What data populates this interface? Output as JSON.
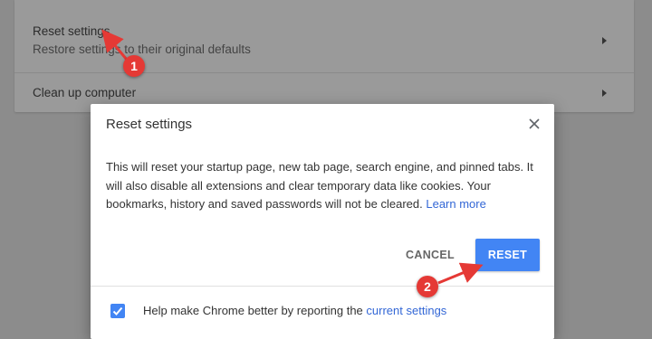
{
  "settings_card": {
    "reset_row": {
      "title": "Reset settings",
      "subtitle": "Restore settings to their original defaults"
    },
    "cleanup_row": {
      "title": "Clean up computer"
    }
  },
  "dialog": {
    "title": "Reset settings",
    "body_text": "This will reset your startup page, new tab page, search engine, and pinned tabs. It will also disable all extensions and clear temporary data like cookies. Your bookmarks, history and saved passwords will not be cleared.",
    "learn_more": "Learn more",
    "cancel_label": "CANCEL",
    "reset_label": "RESET",
    "footer": {
      "checked": true,
      "text": "Help make Chrome better by reporting the",
      "link": "current settings"
    }
  },
  "annotations": {
    "marker_1": "1",
    "marker_2": "2"
  },
  "colors": {
    "accent": "#4285f4",
    "link": "#3367d6",
    "annotation_red": "#e53935"
  }
}
